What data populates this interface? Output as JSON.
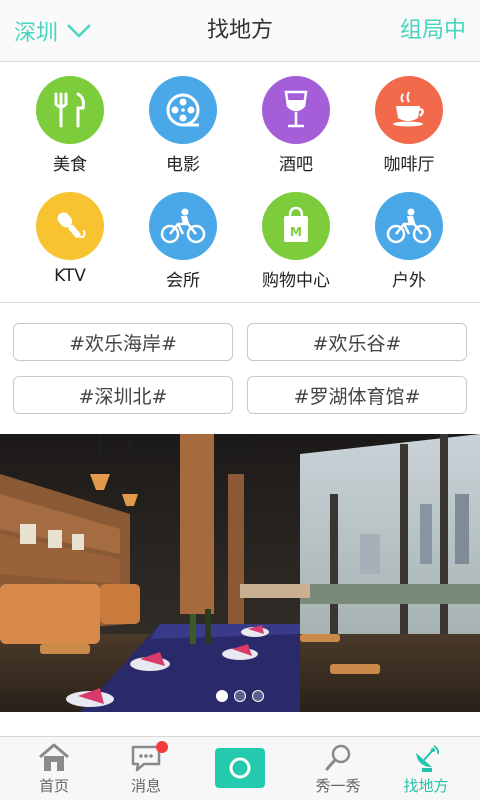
{
  "header": {
    "city": "深圳",
    "title": "找地方",
    "right_action": "组局中"
  },
  "categories": [
    {
      "label": "美食",
      "icon": "fork-knife-icon",
      "color": "#7ccc3c"
    },
    {
      "label": "电影",
      "icon": "film-reel-icon",
      "color": "#4aa8e8"
    },
    {
      "label": "酒吧",
      "icon": "wine-glass-icon",
      "color": "#a45ed8"
    },
    {
      "label": "咖啡厅",
      "icon": "coffee-cup-icon",
      "color": "#f26a4b"
    },
    {
      "label": "KTV",
      "icon": "microphone-icon",
      "color": "#f7c331"
    },
    {
      "label": "会所",
      "icon": "bicycle-icon",
      "color": "#4aa8e8"
    },
    {
      "label": "购物中心",
      "icon": "shopping-bag-icon",
      "color": "#7ccc3c"
    },
    {
      "label": "户外",
      "icon": "bicycle-icon",
      "color": "#4aa8e8"
    }
  ],
  "tags": [
    "#欢乐海岸#",
    "#欢乐谷#",
    "#深圳北#",
    "#罗湖体育馆#"
  ],
  "banner": {
    "slide_count": 3,
    "active_index": 0
  },
  "nav": [
    {
      "label": "首页",
      "icon": "home-icon"
    },
    {
      "label": "消息",
      "icon": "message-icon"
    },
    {
      "label": "",
      "icon": "camera-icon"
    },
    {
      "label": "秀一秀",
      "icon": "magnifier-icon"
    },
    {
      "label": "找地方",
      "icon": "satellite-dish-icon"
    }
  ],
  "colors": {
    "accent": "#46d6c0",
    "nav_active": "#22c3a8",
    "badge": "#f23b3b"
  }
}
